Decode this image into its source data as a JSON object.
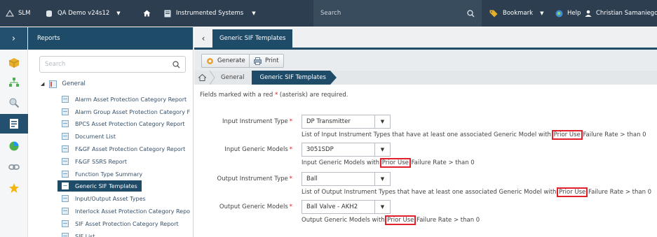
{
  "topbar": {
    "app_name": "SLM",
    "project": "QA Demo v24s12",
    "home": "home-icon",
    "module": "Instrumented Systems",
    "search_placeholder": "Search",
    "bookmark": "Bookmark",
    "help": "Help",
    "user": "Christian Samaniego"
  },
  "sidebar": {
    "title": "Reports",
    "search_placeholder": "Search",
    "folder": "General",
    "items": [
      "Alarm Asset Protection Category Report",
      "Alarm Group Asset Protection Category F",
      "BPCS Asset Protection Category Report",
      "Document List",
      "F&GF Asset Protection Category Report",
      "F&GF SSRS Report",
      "Function Type Summary",
      "Generic SIF Templates",
      "Input/Output Asset Types",
      "Interlock Asset Protection Category Repo",
      "SIF Asset Protection Category Report",
      "SIF List"
    ],
    "active_index": 7
  },
  "main": {
    "tab_label": "Generic SIF Templates",
    "toolbar": {
      "generate": "Generate",
      "print": "Print"
    },
    "breadcrumb": [
      "General",
      "Generic SIF Templates"
    ],
    "required_note_pre": "Fields marked with a red",
    "required_note_star": "*",
    "required_note_post": "(asterisk) are required.",
    "fields": [
      {
        "label": "Input Instrument Type",
        "value": "DP Transmitter",
        "help_pre": "List of Input Instrument Types that have at least one associated Generic Model with",
        "help_hl": "Prior Use",
        "help_post": "Failure Rate > than 0"
      },
      {
        "label": "Input Generic Models",
        "value": "3051SDP",
        "help_pre": "Input Generic Models with",
        "help_hl": "Prior Use",
        "help_post": "Failure Rate > than 0"
      },
      {
        "label": "Output Instrument Type",
        "value": "Ball",
        "help_pre": "List of Output Instrument Types that have at least one associated Generic Model with",
        "help_hl": "Prior Use",
        "help_post": "Failure Rate > than 0"
      },
      {
        "label": "Output Generic Models",
        "value": "Ball Valve - AKH2",
        "help_pre": "Output Generic Models with",
        "help_hl": "Prior Use",
        "help_post": "Failure Rate > than 0"
      }
    ],
    "required_mark": "*"
  },
  "colors": {
    "topbar": "#2c3e4f",
    "accent": "#1e4b68",
    "highlight": "#e0202a",
    "required": "#d02020"
  }
}
